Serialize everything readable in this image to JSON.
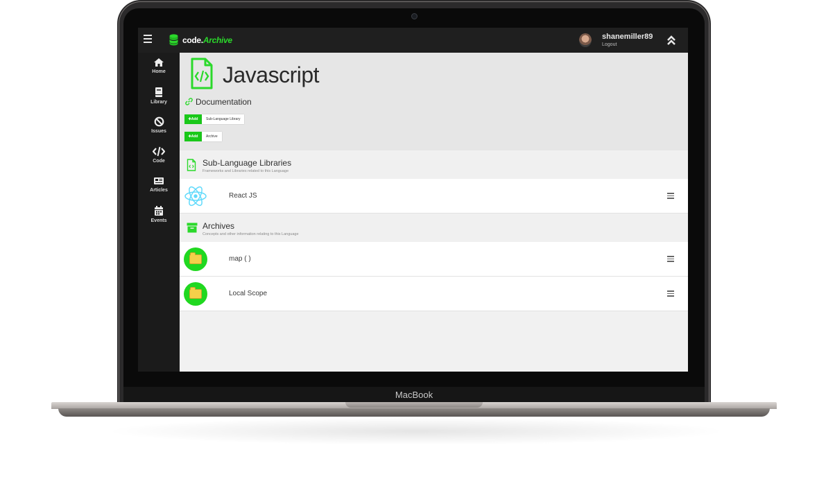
{
  "device": {
    "brand": "MacBook"
  },
  "topbar": {
    "logo_part1": "code.",
    "logo_part2": "Archive",
    "username": "shanemiller89",
    "logout": "Logout"
  },
  "sidebar": {
    "items": [
      {
        "label": "Home",
        "icon": "home-icon"
      },
      {
        "label": "Library",
        "icon": "book-icon"
      },
      {
        "label": "Issues",
        "icon": "ban-icon"
      },
      {
        "label": "Code",
        "icon": "code-icon"
      },
      {
        "label": "Articles",
        "icon": "newspaper-icon"
      },
      {
        "label": "Events",
        "icon": "calendar-icon"
      }
    ]
  },
  "page": {
    "title": "Javascript",
    "documentation_link": "Documentation",
    "add_buttons": [
      {
        "label": "✚Add",
        "tooltip": "Sub-Language Library"
      },
      {
        "label": "✚Add",
        "tooltip": "Archive"
      }
    ]
  },
  "sections": {
    "libraries": {
      "title": "Sub-Language Libraries",
      "subtitle": "Frameworks and Libraries related to this Language",
      "items": [
        {
          "name": "React JS",
          "icon": "react-icon"
        }
      ]
    },
    "archives": {
      "title": "Archives",
      "subtitle": "Concepts and other information relating to this Language",
      "items": [
        {
          "name": "map ( )",
          "icon": "folder-icon"
        },
        {
          "name": "Local Scope",
          "icon": "folder-icon"
        }
      ]
    }
  },
  "colors": {
    "accent": "#2bd92b",
    "topbar": "#1f1f1f",
    "sidebar": "#1b1b1b"
  }
}
